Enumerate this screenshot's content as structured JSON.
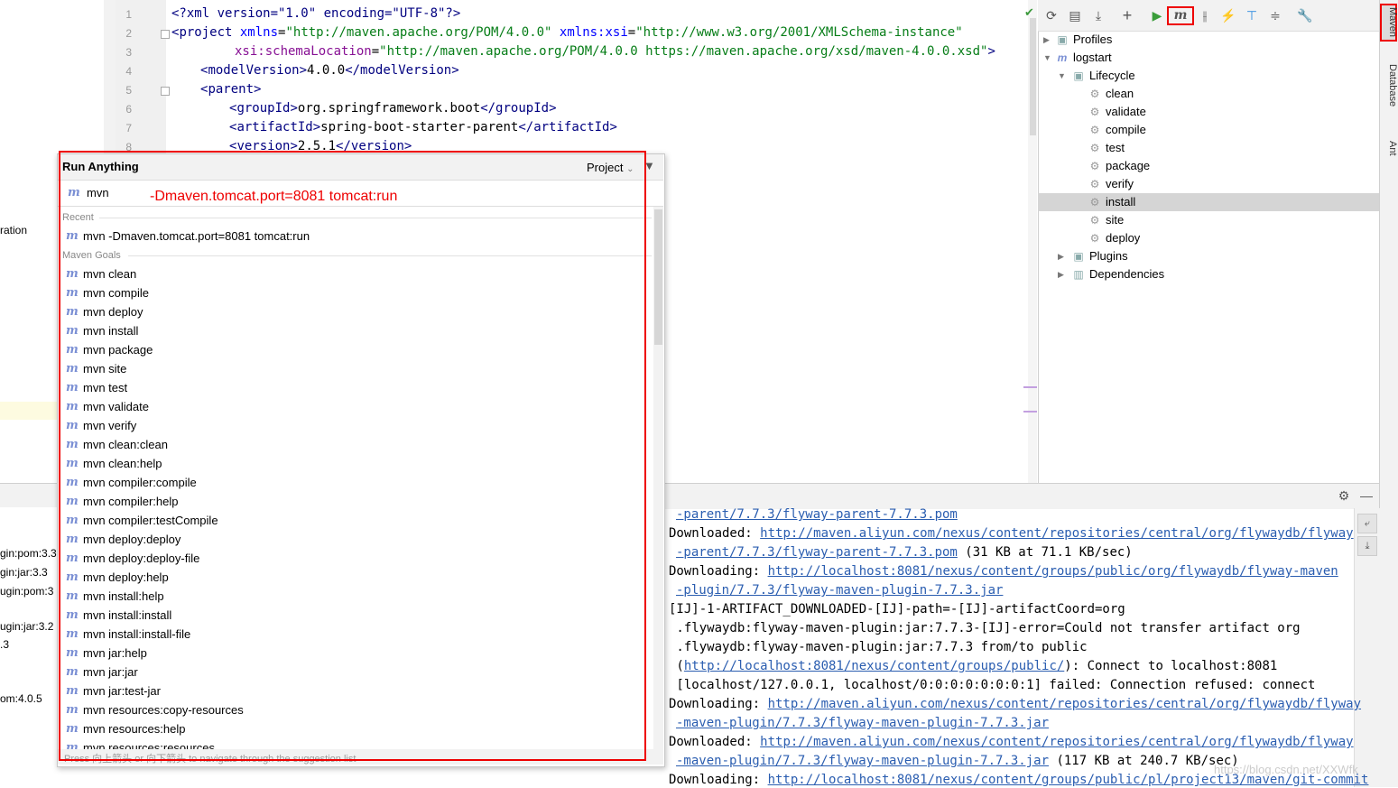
{
  "editor": {
    "line_numbers": [
      "1",
      "2",
      "3",
      "4",
      "5",
      "6",
      "7",
      "8"
    ],
    "line1": "<?xml version=\"1.0\" encoding=\"UTF-8\"?>",
    "line2": {
      "open": "<",
      "tag": "project",
      "a1": " xmlns",
      "eq1": "=",
      "v1": "\"http://maven.apache.org/POM/4.0.0\"",
      "a2": " xmlns:xsi",
      "eq2": "=",
      "v2": "\"http://www.w3.org/2001/XMLSchema-instance\""
    },
    "line3": {
      "a": "xsi:schemaLocation",
      "eq": "=",
      "v": "\"http://maven.apache.org/POM/4.0.0 https://maven.apache.org/xsd/maven-4.0.0.xsd\"",
      "close": ">"
    },
    "line4": {
      "o1": "<",
      "t1": "modelVersion",
      "c1": ">",
      "text": "4.0.0",
      "o2": "</",
      "t2": "modelVersion",
      "c2": ">"
    },
    "line5": {
      "o": "<",
      "t": "parent",
      "c": ">"
    },
    "line6": {
      "o1": "<",
      "t1": "groupId",
      "c1": ">",
      "text": "org.springframework.boot",
      "o2": "</",
      "t2": "groupId",
      "c2": ">"
    },
    "line7": {
      "o1": "<",
      "t1": "artifactId",
      "c1": ">",
      "text": "spring-boot-starter-parent",
      "o2": "</",
      "t2": "artifactId",
      "c2": ">"
    },
    "line8": {
      "o1": "<",
      "t1": "version",
      "c1": ">",
      "text": "2.5.1",
      "o2": "</",
      "t2": "version",
      "c2": ">"
    }
  },
  "left_fragments": [
    "ration",
    "gin:pom:3.3",
    "gin:jar:3.3",
    "ugin:pom:3",
    "ugin:jar:3.2",
    ".3",
    "om:4.0.5"
  ],
  "run_anything": {
    "title": "Run Anything",
    "scope": "Project",
    "scope_arrow": "⌄",
    "filter_icon": "▼",
    "input_value": "mvn",
    "input_hint": "-Dmaven.tomcat.port=8081 tomcat:run",
    "recent_label": "Recent",
    "recent": [
      "mvn -Dmaven.tomcat.port=8081 tomcat:run"
    ],
    "goals_label": "Maven Goals",
    "goals": [
      "mvn clean",
      "mvn compile",
      "mvn deploy",
      "mvn install",
      "mvn package",
      "mvn site",
      "mvn test",
      "mvn validate",
      "mvn verify",
      "mvn clean:clean",
      "mvn clean:help",
      "mvn compiler:compile",
      "mvn compiler:help",
      "mvn compiler:testCompile",
      "mvn deploy:deploy",
      "mvn deploy:deploy-file",
      "mvn deploy:help",
      "mvn install:help",
      "mvn install:install",
      "mvn install:install-file",
      "mvn jar:help",
      "mvn jar:jar",
      "mvn jar:test-jar",
      "mvn resources:copy-resources",
      "mvn resources:help",
      "mvn resources:resources"
    ],
    "footer": "Press 向上箭头 or 向下箭头 to navigate through the suggestion list"
  },
  "maven": {
    "toolbar": {
      "reload": "⟳",
      "add_folder": "▤",
      "download": "⤓",
      "add": "+",
      "run": "▶",
      "run_maven": "m",
      "toggle_offline": "⫲",
      "skip_tests": "⚡",
      "show_deps": "⊤",
      "collapse": "≑",
      "settings": "🔧"
    },
    "tree": {
      "profiles": "Profiles",
      "project": "logstart",
      "lifecycle": "Lifecycle",
      "phases": [
        "clean",
        "validate",
        "compile",
        "test",
        "package",
        "verify",
        "install",
        "site",
        "deploy"
      ],
      "selected_phase": "install",
      "plugins": "Plugins",
      "dependencies": "Dependencies"
    }
  },
  "right_tabs": {
    "maven": "Maven",
    "database": "Database",
    "ant": "Ant"
  },
  "console": {
    "gear": "⚙",
    "minimize": "—",
    "wrap_icon": "⤶",
    "scroll_icon": "⤓",
    "lines": [
      {
        "plain": "",
        "link": "-parent/7.7.3/flyway-parent-7.7.3.pom",
        "tail": ""
      },
      {
        "plain": "Downloaded: ",
        "link": "http://maven.aliyun.com/nexus/content/repositories/central/org/flywaydb/flyway",
        "tail": ""
      },
      {
        "plain": "",
        "link": "-parent/7.7.3/flyway-parent-7.7.3.pom",
        "tail": " (31 KB at 71.1 KB/sec)"
      },
      {
        "plain": "Downloading: ",
        "link": "http://localhost:8081/nexus/content/groups/public/org/flywaydb/flyway-maven",
        "tail": ""
      },
      {
        "plain": "",
        "link": "-plugin/7.7.3/flyway-maven-plugin-7.7.3.jar",
        "tail": ""
      },
      {
        "plain": "[IJ]-1-ARTIFACT_DOWNLOADED-[IJ]-path=-[IJ]-artifactCoord=org",
        "link": "",
        "tail": ""
      },
      {
        "plain": " .flywaydb:flyway-maven-plugin:jar:7.7.3-[IJ]-error=Could not transfer artifact org",
        "link": "",
        "tail": ""
      },
      {
        "plain": " .flywaydb:flyway-maven-plugin:jar:7.7.3 from/to public",
        "link": "",
        "tail": ""
      },
      {
        "plain": " (",
        "link": "http://localhost:8081/nexus/content/groups/public/",
        "tail": "): Connect to localhost:8081"
      },
      {
        "plain": " [localhost/127.0.0.1, localhost/0:0:0:0:0:0:0:1] failed: Connection refused: connect",
        "link": "",
        "tail": ""
      },
      {
        "plain": "Downloading: ",
        "link": "http://maven.aliyun.com/nexus/content/repositories/central/org/flywaydb/flyway",
        "tail": ""
      },
      {
        "plain": "",
        "link": "-maven-plugin/7.7.3/flyway-maven-plugin-7.7.3.jar",
        "tail": ""
      },
      {
        "plain": "Downloaded: ",
        "link": "http://maven.aliyun.com/nexus/content/repositories/central/org/flywaydb/flyway",
        "tail": ""
      },
      {
        "plain": "",
        "link": "-maven-plugin/7.7.3/flyway-maven-plugin-7.7.3.jar",
        "tail": " (117 KB at 240.7 KB/sec)"
      },
      {
        "plain": "Downloading: ",
        "link": "http://localhost:8081/nexus/content/groups/public/pl/project13/maven/git-commit",
        "tail": ""
      }
    ]
  },
  "watermark": "https://blog.csdn.net/XXWfk",
  "editor_status_icon": "✔"
}
